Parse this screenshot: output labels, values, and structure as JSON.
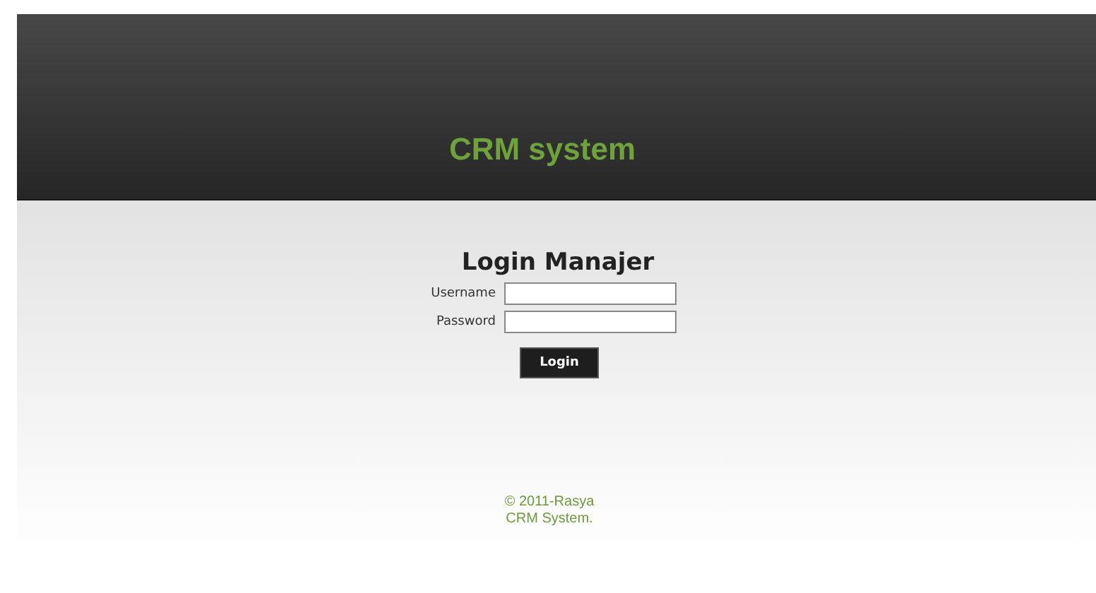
{
  "header": {
    "title": "CRM system"
  },
  "login": {
    "heading": "Login Manajer",
    "fields": [
      {
        "label": "Username"
      },
      {
        "label": "Password"
      }
    ],
    "button": "Login"
  },
  "footer": [
    "© 2011-Rasya",
    "CRM System."
  ]
}
